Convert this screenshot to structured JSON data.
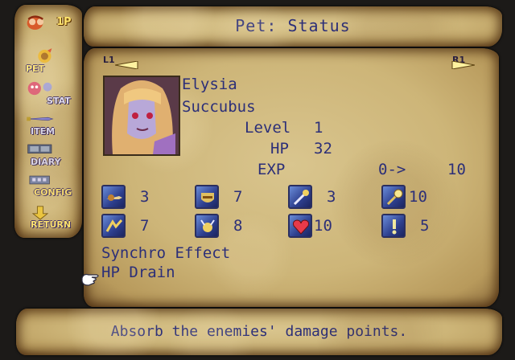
{
  "sidebar": {
    "player_badge": "1P",
    "items": [
      {
        "label": "PET",
        "icon": "pet-icon"
      },
      {
        "label": "STAT",
        "icon": "stat-icon"
      },
      {
        "label": "ITEM",
        "icon": "item-icon"
      },
      {
        "label": "DIARY",
        "icon": "diary-icon"
      },
      {
        "label": "CONFIG",
        "icon": "config-icon"
      },
      {
        "label": "RETURN",
        "icon": "return-icon"
      }
    ]
  },
  "header": {
    "title": "Pet: Status"
  },
  "shoulders": {
    "left": "L1",
    "right": "R1"
  },
  "pet": {
    "name": "Elysia",
    "race": "Succubus",
    "level_label": "Level",
    "level": "1",
    "hp_label": "HP",
    "hp": "32",
    "exp_label": "EXP",
    "exp_current": "0->",
    "exp_next": "10"
  },
  "stats": [
    {
      "icon": "attack-icon",
      "value": "3"
    },
    {
      "icon": "defense-icon",
      "value": "7"
    },
    {
      "icon": "magic-icon",
      "value": "3"
    },
    {
      "icon": "wand-icon",
      "value": "10"
    },
    {
      "icon": "speed-icon",
      "value": "7"
    },
    {
      "icon": "spirit-icon",
      "value": "8"
    },
    {
      "icon": "heart-icon",
      "value": "10"
    },
    {
      "icon": "luck-icon",
      "value": "5"
    }
  ],
  "synchro": {
    "heading": "Synchro Effect",
    "effect": "HP Drain"
  },
  "description": "Absorb the enemies' damage points.",
  "colors": {
    "text": "#2c2f78",
    "parchment": "#cdb578",
    "burnt_edge": "#1c1a18"
  }
}
